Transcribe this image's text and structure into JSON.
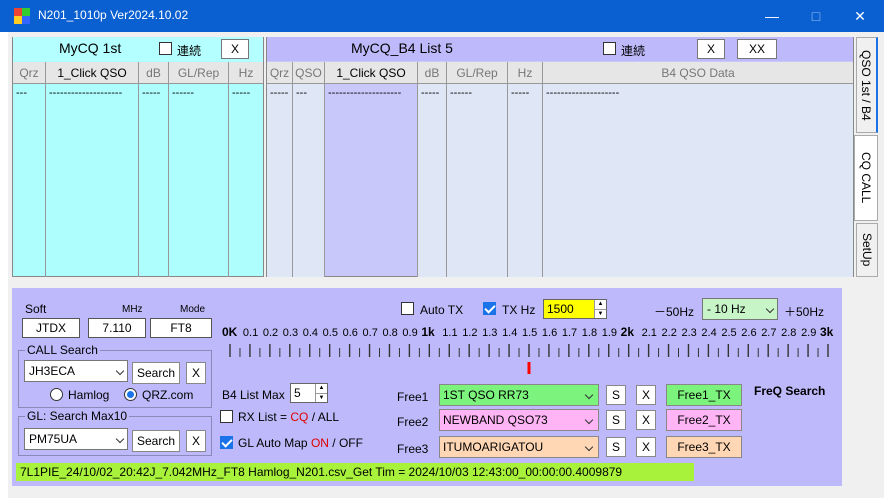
{
  "window": {
    "title": "N201_1010p Ver2024.10.02",
    "minimize": "—",
    "maximize": "□",
    "close": "✕"
  },
  "left_panel": {
    "title": "MyCQ 1st",
    "renzoku": "連続",
    "x_label": "X",
    "columns": [
      "Qrz",
      "1_Click QSO",
      "dB",
      "GL/Rep",
      "Hz"
    ],
    "row": [
      "---",
      "--------------------",
      "-----",
      "------",
      "-----"
    ]
  },
  "right_panel": {
    "title": "MyCQ_B4 List 5",
    "renzoku": "連続",
    "x_label": "X",
    "xx_label": "XX",
    "columns": [
      "Qrz",
      "QSO",
      "1_Click QSO",
      "dB",
      "GL/Rep",
      "Hz",
      "B4 QSO Data"
    ],
    "row": [
      "-----",
      "---",
      "--------------------",
      "-----",
      "------",
      "-----",
      "--------------------"
    ]
  },
  "tabs": [
    "QSO 1st / B4",
    "CQ CALL",
    "SetUp"
  ],
  "soft": {
    "soft_label": "Soft",
    "mhz_label": "MHz",
    "mode_label": "Mode",
    "soft_value": "JTDX",
    "mhz_value": "7.110",
    "mode_value": "FT8"
  },
  "call_search": {
    "label": "CALL Search",
    "value": "JH3ECA",
    "search": "Search",
    "x": "X",
    "hamlog": "Hamlog",
    "qrz": "QRZ.com"
  },
  "gl_search": {
    "label": "GL: Search Max10",
    "value": "PM75UA",
    "search": "Search",
    "x": "X"
  },
  "b4": {
    "label": "B4 List Max",
    "value": "5"
  },
  "rxlist": {
    "prefix": "RX List = ",
    "cq": "CQ",
    "sep": " / ",
    "all": "ALL"
  },
  "glmap": {
    "prefix": "GL Auto Map ",
    "on": "ON",
    "sep": " / ",
    "off": "OFF"
  },
  "tx": {
    "auto_tx": "Auto TX",
    "tx_hz_label": "TX Hz",
    "tx_hz_value": "1500",
    "minus": "－50Hz",
    "step": "- 10 Hz",
    "plus": "＋50Hz"
  },
  "scale": {
    "labels": [
      "0K",
      "0.1",
      "0.2",
      "0.3",
      "0.4",
      "0.5",
      "0.6",
      "0.7",
      "0.8",
      "0.9",
      "1k",
      "1.1",
      "1.2",
      "1.3",
      "1.4",
      "1.5",
      "1.6",
      "1.7",
      "1.8",
      "1.9",
      "2k",
      "2.1",
      "2.2",
      "2.3",
      "2.4",
      "2.5",
      "2.6",
      "2.7",
      "2.8",
      "2.9",
      "3k"
    ],
    "marker_value": 1500,
    "max": 3000
  },
  "free": [
    {
      "label": "Free1",
      "text": "1ST QSO RR73",
      "s": "S",
      "x": "X",
      "tx": "Free1_TX",
      "color": "#7cf37c"
    },
    {
      "label": "Free2",
      "text": "NEWBAND QSO73",
      "s": "S",
      "x": "X",
      "tx": "Free2_TX",
      "color": "#ffb4f5"
    },
    {
      "label": "Free3",
      "text": "ITUMOARIGATOU",
      "s": "S",
      "x": "X",
      "tx": "Free3_TX",
      "color": "#ffd7b4"
    }
  ],
  "freq_search": "FreQ Search",
  "status": "7L1PIE_24/10/02_20:42J_7.042MHz_FT8     Hamlog_N201.csv_Get Tim = 2024/10/03 12:43:00_00:00:00.4009879",
  "colors": {
    "titlebar": "#0a5fd1",
    "left_bg": "#aefefe",
    "right_bg": "#c8c8fa",
    "bottom_bg": "#beb9fa",
    "status": "#a8f23c",
    "tx_hz": "#ffff00",
    "marker": "#ff0000"
  }
}
